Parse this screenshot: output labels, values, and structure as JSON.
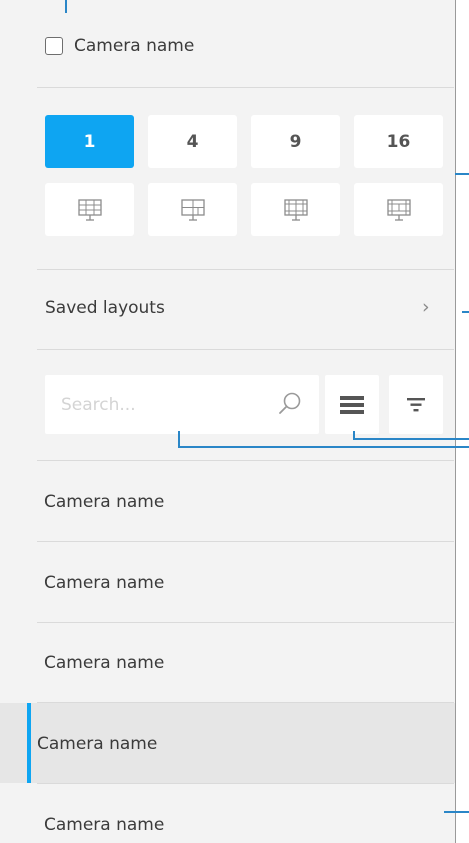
{
  "header": {
    "select_all_label": "Camera name"
  },
  "grid_layouts": {
    "counts": [
      "1",
      "4",
      "9",
      "16"
    ],
    "active": "1",
    "layout_icons": [
      "layout-1-icon",
      "layout-4-icon",
      "layout-9-icon",
      "layout-16-icon"
    ]
  },
  "saved_layouts": {
    "label": "Saved layouts",
    "chevron": "›"
  },
  "search": {
    "placeholder": "Search...",
    "value": ""
  },
  "toolbar": {
    "list_view_icon": "list-view-icon",
    "filter_icon": "filter-icon"
  },
  "cameras": [
    {
      "name": "Camera name",
      "selected": false
    },
    {
      "name": "Camera name",
      "selected": false
    },
    {
      "name": "Camera name",
      "selected": false
    },
    {
      "name": "Camera name",
      "selected": true
    },
    {
      "name": "Camera name",
      "selected": false
    }
  ],
  "colors": {
    "accent": "#0ea5f2",
    "panel_bg": "#f3f3f3",
    "callout": "#2a86c7",
    "selected_row_bg": "#e6e6e6"
  }
}
